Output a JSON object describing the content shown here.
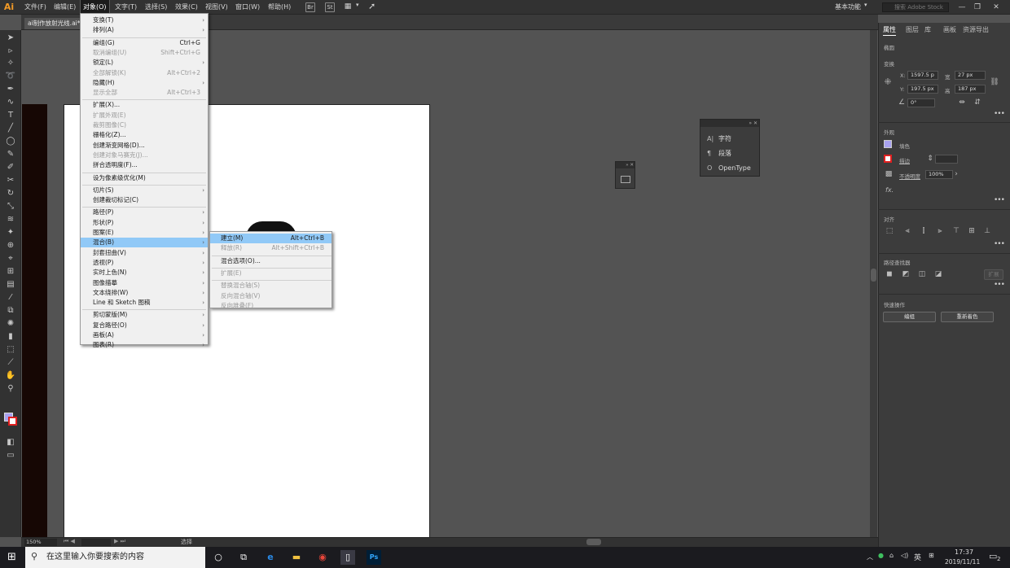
{
  "app": {
    "logo": "Ai",
    "workspace": "基本功能",
    "search_placeholder": "搜索 Adobe Stock"
  },
  "menubar": [
    "文件(F)",
    "编辑(E)",
    "对象(O)",
    "文字(T)",
    "选择(S)",
    "效果(C)",
    "视图(V)",
    "窗口(W)",
    "帮助(H)"
  ],
  "toolbar_icons": {
    "br": "Br",
    "st": "St"
  },
  "document": {
    "tab": "ai制作放射光线.ai*",
    "zoom": "150%",
    "status": "选择"
  },
  "object_menu": {
    "items": [
      {
        "label": "变换(T)",
        "submenu": true
      },
      {
        "label": "排列(A)",
        "submenu": true
      },
      {
        "sep": true
      },
      {
        "label": "编组(G)",
        "shortcut": "Ctrl+G"
      },
      {
        "label": "取消编组(U)",
        "shortcut": "Shift+Ctrl+G",
        "disabled": true
      },
      {
        "label": "锁定(L)",
        "submenu": true
      },
      {
        "label": "全部解锁(K)",
        "shortcut": "Alt+Ctrl+2",
        "disabled": true
      },
      {
        "label": "隐藏(H)",
        "submenu": true
      },
      {
        "label": "显示全部",
        "shortcut": "Alt+Ctrl+3",
        "disabled": true
      },
      {
        "sep": true
      },
      {
        "label": "扩展(X)..."
      },
      {
        "label": "扩展外观(E)",
        "disabled": true
      },
      {
        "label": "裁剪图像(C)",
        "disabled": true
      },
      {
        "label": "栅格化(Z)..."
      },
      {
        "label": "创建渐变网格(D)..."
      },
      {
        "label": "创建对象马赛克(J)...",
        "disabled": true
      },
      {
        "label": "拼合透明度(F)..."
      },
      {
        "sep": true
      },
      {
        "label": "设为像素级优化(M)"
      },
      {
        "sep": true
      },
      {
        "label": "切片(S)",
        "submenu": true
      },
      {
        "label": "创建裁切标记(C)"
      },
      {
        "sep": true
      },
      {
        "label": "路径(P)",
        "submenu": true
      },
      {
        "label": "形状(P)",
        "submenu": true
      },
      {
        "label": "图案(E)",
        "submenu": true
      },
      {
        "label": "混合(B)",
        "submenu": true,
        "highlight": true
      },
      {
        "label": "封套扭曲(V)",
        "submenu": true
      },
      {
        "label": "透视(P)",
        "submenu": true
      },
      {
        "label": "实时上色(N)",
        "submenu": true
      },
      {
        "label": "图像描摹",
        "submenu": true
      },
      {
        "label": "文本绕排(W)",
        "submenu": true
      },
      {
        "label": "Line 和 Sketch 图稿",
        "submenu": true
      },
      {
        "sep": true
      },
      {
        "label": "剪切蒙版(M)",
        "submenu": true
      },
      {
        "label": "复合路径(O)",
        "submenu": true
      },
      {
        "label": "画板(A)",
        "submenu": true
      },
      {
        "label": "图表(R)",
        "submenu": true
      }
    ]
  },
  "blend_menu": {
    "items": [
      {
        "label": "建立(M)",
        "shortcut": "Alt+Ctrl+B",
        "highlight": true
      },
      {
        "label": "释放(R)",
        "shortcut": "Alt+Shift+Ctrl+B",
        "disabled": true
      },
      {
        "sep": true
      },
      {
        "label": "混合选项(O)..."
      },
      {
        "sep": true
      },
      {
        "label": "扩展(E)",
        "disabled": true
      },
      {
        "sep": true
      },
      {
        "label": "替换混合轴(S)",
        "disabled": true
      },
      {
        "label": "反向混合轴(V)",
        "disabled": true
      },
      {
        "label": "反向堆叠(F)",
        "disabled": true
      }
    ]
  },
  "char_panel": {
    "items": [
      "字符",
      "段落",
      "OpenType"
    ]
  },
  "properties": {
    "tabs": [
      "属性",
      "图层",
      "库",
      "画板",
      "资源导出"
    ],
    "object_type": "椭圆",
    "transform": {
      "title": "变换",
      "x_label": "X:",
      "x": "1597.5 p",
      "y_label": "Y:",
      "y": "197.5 px",
      "w_label": "宽",
      "w": "27 px",
      "h_label": "高",
      "h": "187 px",
      "angle": "0°"
    },
    "appearance": {
      "title": "外观",
      "fill_label": "填色",
      "stroke_label": "描边",
      "opacity_label": "不透明度",
      "opacity": "100%",
      "fx": "fx."
    },
    "align_title": "对齐",
    "pathfinder_title": "路径查找器",
    "pathfinder_btn": "扩展",
    "quick_title": "快速操作",
    "quick_buttons": [
      "编组",
      "重新着色"
    ],
    "fill_color": "#a8a2f0",
    "stroke_color": "#e02020"
  },
  "taskbar": {
    "search": "在这里输入你要搜索的内容",
    "time": "17:37",
    "date": "2019/11/11",
    "lang": "英",
    "notif": "2"
  }
}
